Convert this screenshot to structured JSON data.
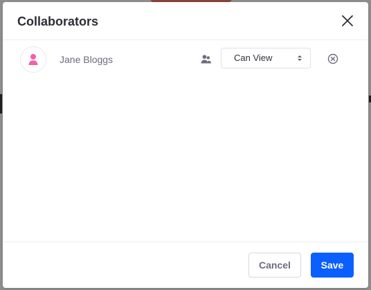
{
  "modal": {
    "title": "Collaborators",
    "close_icon": "close-icon"
  },
  "collaborators": [
    {
      "name": "Jane Bloggs",
      "avatar_icon": "user-icon",
      "group_icon": "users-icon",
      "permission": "Can View",
      "remove_icon": "remove-circle-icon"
    }
  ],
  "footer": {
    "cancel_label": "Cancel",
    "save_label": "Save"
  },
  "colors": {
    "backdrop": "#8d8d8d",
    "accent": "#0b5fff",
    "avatar_icon": "#f35fa8",
    "header_text": "#2d2d36",
    "secondary_text": "#6b6c7e"
  }
}
